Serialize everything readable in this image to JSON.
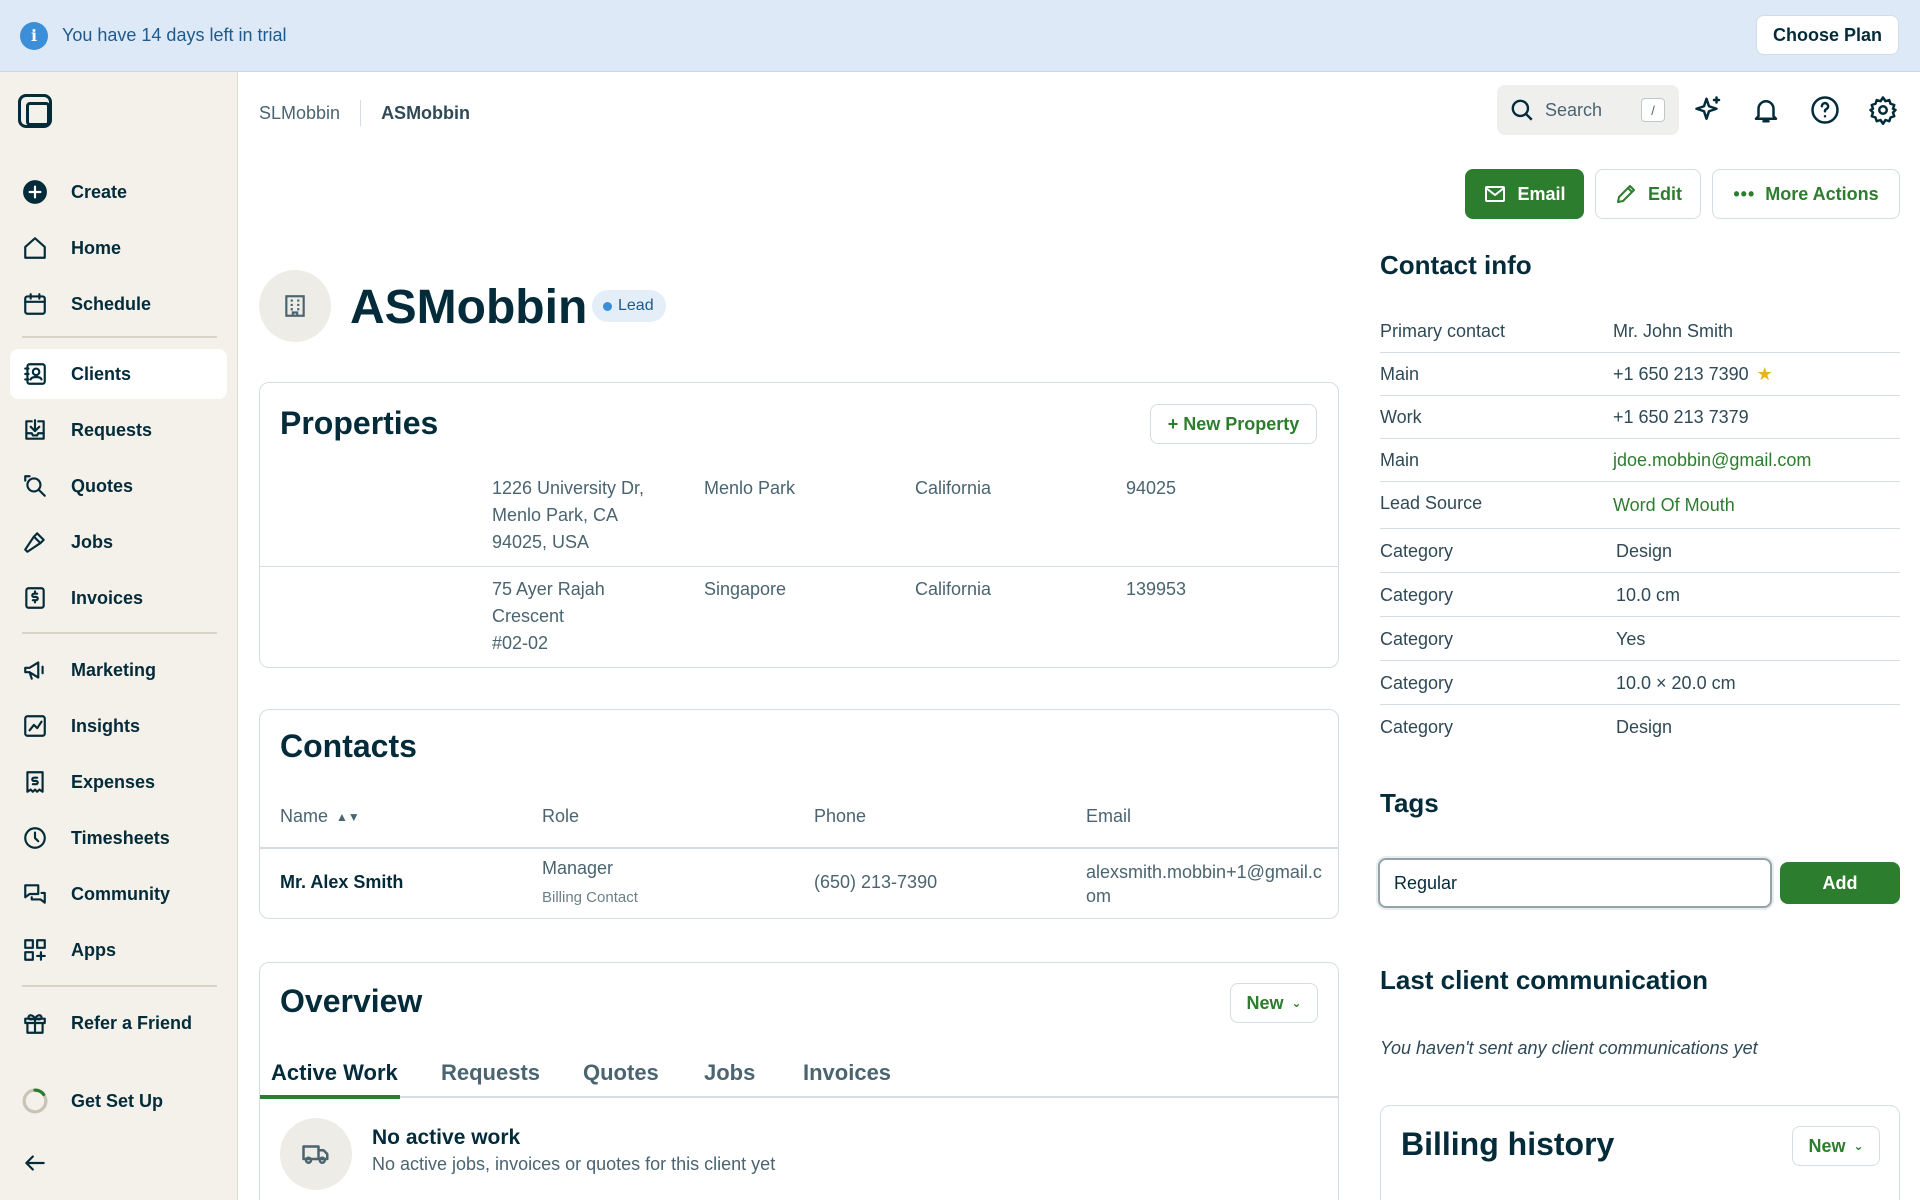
{
  "banner": {
    "trial_text": "You have 14 days left in trial",
    "choose_plan": "Choose Plan"
  },
  "sidebar": {
    "items": [
      {
        "label": "Create",
        "icon": "plus-circle-icon"
      },
      {
        "label": "Home",
        "icon": "home-icon"
      },
      {
        "label": "Schedule",
        "icon": "calendar-icon"
      },
      {
        "label": "Clients",
        "icon": "contacts-book-icon",
        "active": true
      },
      {
        "label": "Requests",
        "icon": "inbox-download-icon"
      },
      {
        "label": "Quotes",
        "icon": "quote-search-icon"
      },
      {
        "label": "Jobs",
        "icon": "hammer-icon"
      },
      {
        "label": "Invoices",
        "icon": "invoice-dollar-icon"
      },
      {
        "label": "Marketing",
        "icon": "megaphone-icon"
      },
      {
        "label": "Insights",
        "icon": "chart-line-icon"
      },
      {
        "label": "Expenses",
        "icon": "receipt-dollar-icon"
      },
      {
        "label": "Timesheets",
        "icon": "clock-icon"
      },
      {
        "label": "Community",
        "icon": "chat-bubbles-icon"
      },
      {
        "label": "Apps",
        "icon": "apps-grid-icon"
      },
      {
        "label": "Refer a Friend",
        "icon": "gift-icon"
      },
      {
        "label": "Get Set Up",
        "icon": "progress-ring-icon"
      }
    ],
    "collapse_icon": "arrow-left-icon"
  },
  "header": {
    "breadcrumb": [
      "SLMobbin",
      "ASMobbin"
    ],
    "search_placeholder": "Search",
    "search_shortcut": "/"
  },
  "actions": {
    "email": "Email",
    "edit": "Edit",
    "more": "More Actions"
  },
  "client": {
    "name": "ASMobbin",
    "badge": "Lead"
  },
  "properties": {
    "title": "Properties",
    "new_button": "+ New Property",
    "rows": [
      {
        "address": "1226 University Dr,\nMenlo Park, CA\n94025, USA",
        "city": "Menlo Park",
        "state": "California",
        "zip": "94025"
      },
      {
        "address": "75 Ayer Rajah\nCrescent\n#02-02",
        "city": "Singapore",
        "state": "California",
        "zip": "139953"
      }
    ]
  },
  "contacts": {
    "title": "Contacts",
    "headers": {
      "name": "Name",
      "role": "Role",
      "phone": "Phone",
      "email": "Email"
    },
    "rows": [
      {
        "name": "Mr. Alex Smith",
        "role": "Manager",
        "role_sub": "Billing Contact",
        "phone": "(650) 213-7390",
        "email": "alexsmith.mobbin+1@gmail.com"
      }
    ]
  },
  "overview": {
    "title": "Overview",
    "new_button": "New",
    "tabs": [
      "Active Work",
      "Requests",
      "Quotes",
      "Jobs",
      "Invoices"
    ],
    "active_tab": "Active Work",
    "empty_title": "No active work",
    "empty_sub": "No active jobs, invoices or quotes for this client yet"
  },
  "contact_info": {
    "title": "Contact info",
    "rows": [
      {
        "label": "Primary contact",
        "value": "Mr. John Smith"
      },
      {
        "label": "Main",
        "value": "+1 650 213 7390",
        "starred": true
      },
      {
        "label": "Work",
        "value": "+1 650 213 7379"
      },
      {
        "label": "Main",
        "value": "jdoe.mobbin@gmail.com",
        "link": true
      },
      {
        "label": "Lead Source",
        "value": "Word Of Mouth",
        "link": true
      },
      {
        "label": "Category",
        "value": "Design"
      },
      {
        "label": "Category",
        "value": "10.0 cm"
      },
      {
        "label": "Category",
        "value": "Yes"
      },
      {
        "label": "Category",
        "value": "10.0 × 20.0 cm"
      },
      {
        "label": "Category",
        "value": "Design"
      }
    ]
  },
  "tags": {
    "title": "Tags",
    "input_value": "Regular",
    "add_button": "Add"
  },
  "last_comm": {
    "title": "Last client communication",
    "text": "You haven't sent any client communications yet"
  },
  "billing": {
    "title": "Billing history",
    "new_button": "New"
  },
  "colors": {
    "brand_green": "#2d7d2e",
    "navy": "#032b3a",
    "banner_blue": "#dde9f6",
    "sidebar_bg": "#f4f1ea"
  }
}
